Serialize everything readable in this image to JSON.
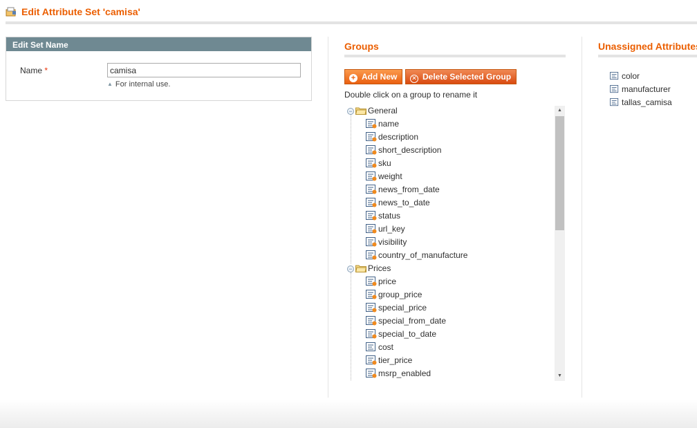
{
  "header": {
    "title": "Edit Attribute Set 'camisa'"
  },
  "set_name_box": {
    "heading": "Edit Set Name",
    "name_label": "Name",
    "required_mark": "*",
    "name_value": "camisa",
    "note": "For internal use."
  },
  "groups": {
    "title": "Groups",
    "add_button": "Add New",
    "delete_button": "Delete Selected Group",
    "hint": "Double click on a group to rename it",
    "tree": [
      {
        "group": "General",
        "items": [
          "name",
          "description",
          "short_description",
          "sku",
          "weight",
          "news_from_date",
          "news_to_date",
          "status",
          "url_key",
          "visibility",
          "country_of_manufacture"
        ]
      },
      {
        "group": "Prices",
        "items": [
          "price",
          "group_price",
          "special_price",
          "special_from_date",
          "special_to_date",
          "cost",
          "tier_price",
          "msrp_enabled"
        ]
      }
    ]
  },
  "unassigned": {
    "title": "Unassigned Attributes",
    "items": [
      "color",
      "manufacturer",
      "tallas_camisa"
    ]
  },
  "colors": {
    "accent": "#eb5e00",
    "box_header": "#6f8992",
    "button": "#ea6010"
  },
  "icons": {
    "header": "attribute-set-icon",
    "group": "folder-icon",
    "attribute": "attribute-icon",
    "toggle": "collapse-icon"
  }
}
